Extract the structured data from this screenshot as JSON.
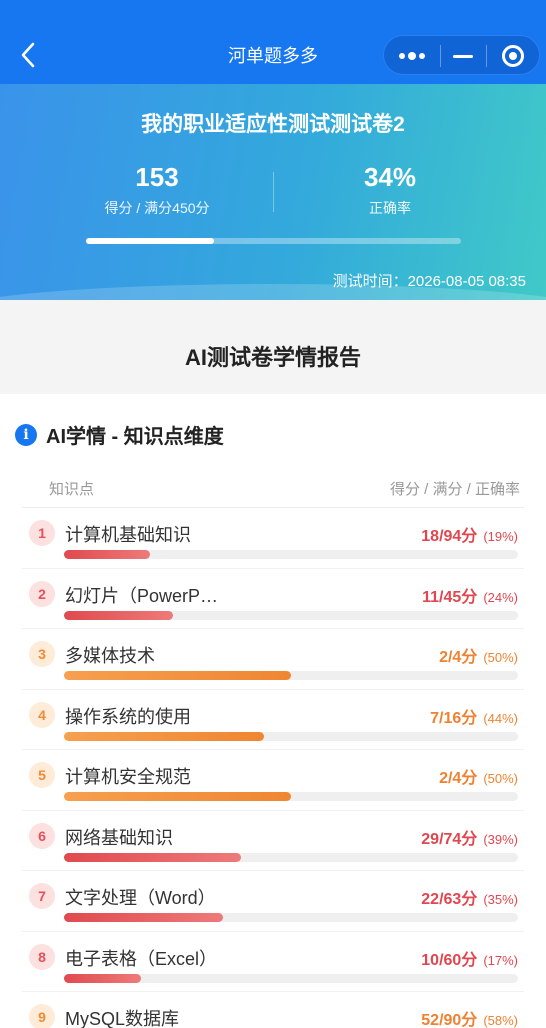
{
  "nav": {
    "title": "河单题多多"
  },
  "exam": {
    "title": "我的职业适应性测试测试卷2",
    "score_value": "153",
    "score_label": "得分 / 满分450分",
    "rate_value": "34%",
    "rate_label": "正确率",
    "progress_fraction": 0.34,
    "test_time": "测试时间：2026-08-05 08:35"
  },
  "report": {
    "title": "AI测试卷学情报告"
  },
  "section": {
    "icon_glyph": "i",
    "title": "AI学情 - 知识点维度",
    "col_left": "知识点",
    "col_right": "得分 / 满分 / 正确率"
  },
  "colors": {
    "nav_blue": "#1677f0",
    "low_red": "#e0474e",
    "mid_orange": "#ef8230"
  },
  "items": [
    {
      "num": "1",
      "name": "计算机基础知识",
      "score": "18/94分",
      "pct": "(19%)",
      "rate": 0.19,
      "level": "red"
    },
    {
      "num": "2",
      "name": "幻灯片（PowerP…",
      "score": "11/45分",
      "pct": "(24%)",
      "rate": 0.24,
      "level": "red"
    },
    {
      "num": "3",
      "name": "多媒体技术",
      "score": "2/4分",
      "pct": "(50%)",
      "rate": 0.5,
      "level": "orange"
    },
    {
      "num": "4",
      "name": "操作系统的使用",
      "score": "7/16分",
      "pct": "(44%)",
      "rate": 0.44,
      "level": "orange"
    },
    {
      "num": "5",
      "name": "计算机安全规范",
      "score": "2/4分",
      "pct": "(50%)",
      "rate": 0.5,
      "level": "orange"
    },
    {
      "num": "6",
      "name": "网络基础知识",
      "score": "29/74分",
      "pct": "(39%)",
      "rate": 0.39,
      "level": "red"
    },
    {
      "num": "7",
      "name": "文字处理（Word）",
      "score": "22/63分",
      "pct": "(35%)",
      "rate": 0.35,
      "level": "red"
    },
    {
      "num": "8",
      "name": "电子表格（Excel）",
      "score": "10/60分",
      "pct": "(17%)",
      "rate": 0.17,
      "level": "red"
    },
    {
      "num": "9",
      "name": "MySQL数据库",
      "score": "52/90分",
      "pct": "(58%)",
      "rate": 0.58,
      "level": "orange"
    }
  ]
}
